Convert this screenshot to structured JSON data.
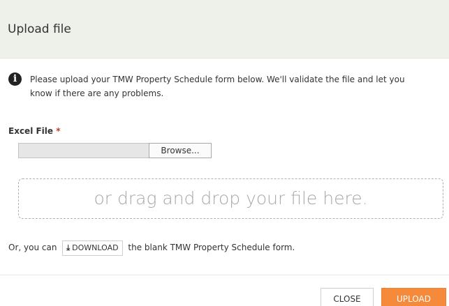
{
  "header": {
    "title": "Upload file"
  },
  "info": {
    "icon": "info-icon",
    "text": "Please upload your TMW Property Schedule form below. We'll validate the file and let you know if there are any problems."
  },
  "file_field": {
    "label": "Excel File",
    "required_mark": "*",
    "value": "",
    "browse_label": "Browse..."
  },
  "dropzone": {
    "text": "or drag and drop your file here."
  },
  "download": {
    "prefix": "Or, you can",
    "button_icon": "download-icon",
    "button_label": "DOWNLOAD",
    "suffix": "the blank TMW Property Schedule form."
  },
  "footer": {
    "close_label": "CLOSE",
    "upload_label": "UPLOAD"
  },
  "colors": {
    "header_background": "#eef0ea",
    "accent": "#f58a3b",
    "required": "#c0392b"
  }
}
